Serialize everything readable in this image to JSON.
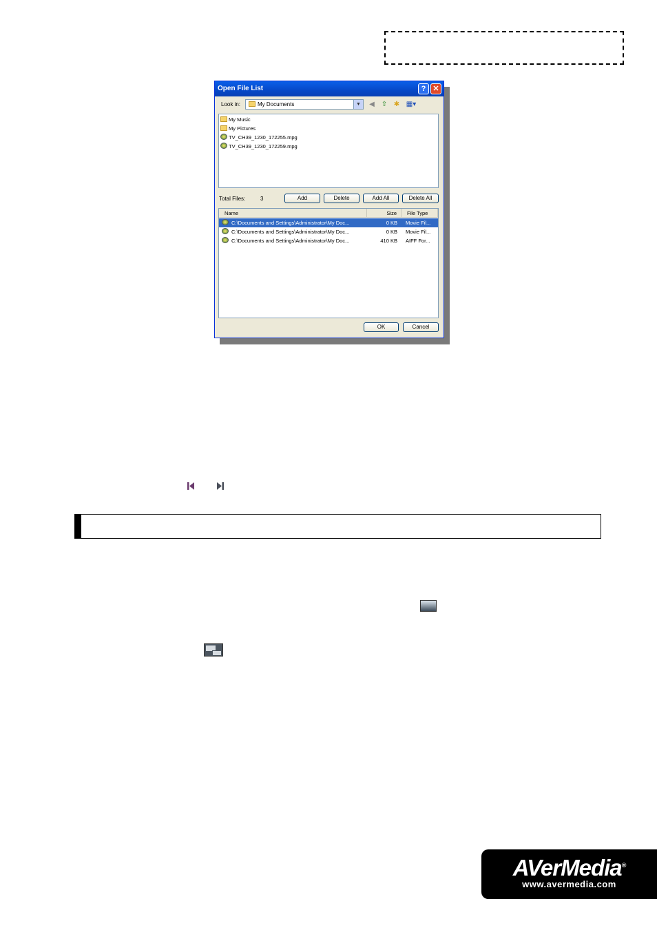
{
  "dialog": {
    "title": "Open File List",
    "help_glyph": "?",
    "close_glyph": "✕",
    "look_in_label": "Look in:",
    "look_in_value": "My Documents",
    "top_list": [
      {
        "icon": "folder-icon",
        "name": "My Music"
      },
      {
        "icon": "folder-icon",
        "name": "My Pictures"
      },
      {
        "icon": "media-file-icon",
        "name": "TV_CH39_1230_172255.mpg"
      },
      {
        "icon": "media-file-icon",
        "name": "TV_CH39_1230_172259.mpg"
      }
    ],
    "total_files_label": "Total Files:",
    "total_files_value": "3",
    "buttons": {
      "add": "Add",
      "delete": "Delete",
      "add_all": "Add All",
      "delete_all": "Delete All",
      "ok": "OK",
      "cancel": "Cancel"
    },
    "columns": {
      "name": "Name",
      "size": "Size",
      "type": "File Type"
    },
    "rows": [
      {
        "name": "C:\\Documents and Settings\\Administrator\\My Doc...",
        "size": "0 KB",
        "type": "Movie Fil...",
        "selected": true
      },
      {
        "name": "C:\\Documents and Settings\\Administrator\\My Doc...",
        "size": "0 KB",
        "type": "Movie Fil...",
        "selected": false
      },
      {
        "name": "C:\\Documents and Settings\\Administrator\\My Doc...",
        "size": "410 KB",
        "type": "AIFF For...",
        "selected": false
      }
    ]
  },
  "logo": {
    "main": "AVerMedia",
    "mark": "®",
    "url": "www.avermedia.com"
  },
  "colors": {
    "titlebar": "#0a5fe8",
    "selection": "#316ac5",
    "media_button": "#6b3b6e"
  }
}
